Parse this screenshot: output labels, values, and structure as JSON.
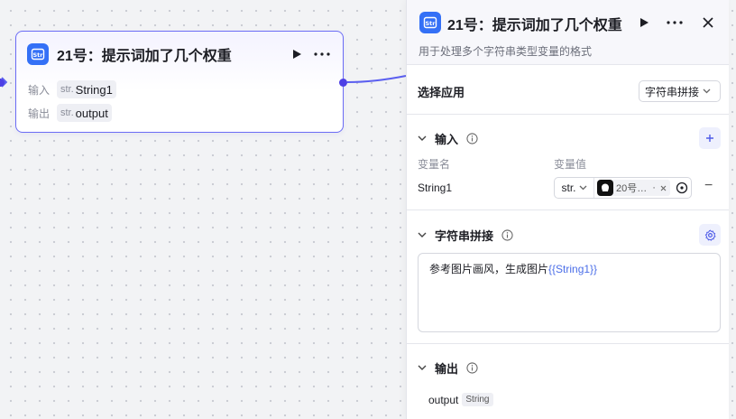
{
  "colors": {
    "accent": "#4e40e5",
    "node_border": "#6b6cf5",
    "logo_bg": "#3470f6",
    "variable_highlight": "#4b6ee8"
  },
  "node": {
    "title": "21号：提示词加了几个权重",
    "input_label": "输入",
    "input_type": "str.",
    "input_name": "String1",
    "output_label": "输出",
    "output_type": "str.",
    "output_name": "output"
  },
  "panel": {
    "title": "21号：提示词加了几个权重",
    "description": "用于处理多个字符串类型变量的格式",
    "select_app_label": "选择应用",
    "select_app_value": "字符串拼接",
    "input_section": {
      "title": "输入",
      "col_var_name": "变量名",
      "col_var_value": "变量值",
      "var_name": "String1",
      "var_type": "str.",
      "var_ref": "20号…",
      "var_ref_extra": "·"
    },
    "concat_section": {
      "title": "字符串拼接",
      "text_prefix": "参考图片画风，生成图片",
      "text_var": "{{String1}}"
    },
    "output_section": {
      "title": "输出",
      "var_name": "output",
      "var_type": "String"
    }
  }
}
